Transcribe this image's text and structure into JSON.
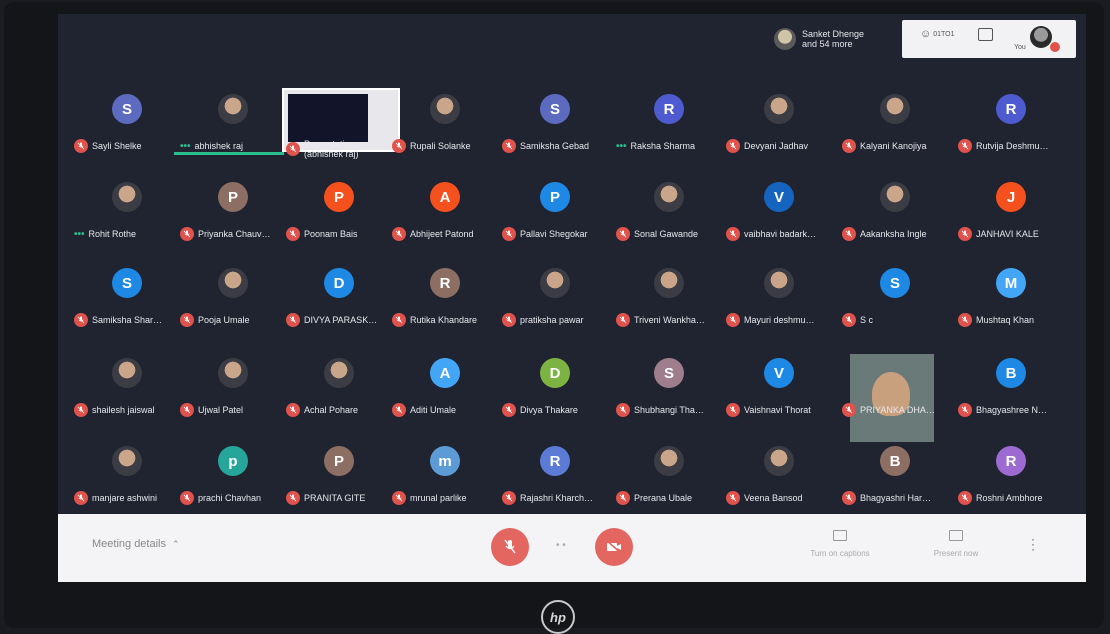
{
  "topbar": {
    "participants_text_line1": "Sanket Dhenge",
    "participants_text_line2": "and 54 more",
    "people_count": "01TO1",
    "you_label": "You"
  },
  "rows": [
    [
      {
        "name": "Sayli Shelke",
        "initial": "S",
        "color": "#5c6bc0",
        "muted": true
      },
      {
        "name": "abhishek raj",
        "initial": "",
        "color": "",
        "muted": false,
        "speaking": true
      },
      {
        "name": "Presentation (abhishek raj)",
        "initial": "",
        "color": "",
        "muted": true,
        "presentation": true
      },
      {
        "name": "Rupali Solanke",
        "initial": "",
        "color": "",
        "muted": true
      },
      {
        "name": "Samiksha Gebad",
        "initial": "S",
        "color": "#5c6bc0",
        "muted": true
      },
      {
        "name": "Raksha Sharma",
        "initial": "R",
        "color": "#4e5bd0",
        "muted": false,
        "speaking": true
      },
      {
        "name": "Devyani Jadhav",
        "initial": "",
        "color": "",
        "muted": true
      },
      {
        "name": "Kalyani Kanojiya",
        "initial": "",
        "color": "",
        "muted": true
      },
      {
        "name": "Rutvija Deshmu…",
        "initial": "R",
        "color": "#4e5bd0",
        "muted": true
      }
    ],
    [
      {
        "name": "Rohit Rothe",
        "initial": "",
        "color": "",
        "muted": false,
        "speaking": true
      },
      {
        "name": "Priyanka Chauv…",
        "initial": "P",
        "color": "#8d6e63",
        "muted": true
      },
      {
        "name": "Poonam Bais",
        "initial": "P",
        "color": "#f4511e",
        "muted": true
      },
      {
        "name": "Abhijeet Patond",
        "initial": "A",
        "color": "#f4511e",
        "muted": true
      },
      {
        "name": "Pallavi Shegokar",
        "initial": "P",
        "color": "#1e88e5",
        "muted": true
      },
      {
        "name": "Sonal Gawande",
        "initial": "",
        "color": "",
        "muted": true
      },
      {
        "name": "vaibhavi badark…",
        "initial": "V",
        "color": "#1565c0",
        "muted": true
      },
      {
        "name": "Aakanksha Ingle",
        "initial": "",
        "color": "",
        "muted": true
      },
      {
        "name": "JANHAVI KALE",
        "initial": "J",
        "color": "#f4511e",
        "muted": true
      }
    ],
    [
      {
        "name": "Samiksha Shar…",
        "initial": "S",
        "color": "#1e88e5",
        "muted": true
      },
      {
        "name": "Pooja Umale",
        "initial": "",
        "color": "",
        "muted": true
      },
      {
        "name": "DIVYA PARASK…",
        "initial": "D",
        "color": "#1e88e5",
        "muted": true
      },
      {
        "name": "Rutika Khandare",
        "initial": "R",
        "color": "#8d6e63",
        "muted": true
      },
      {
        "name": "pratiksha pawar",
        "initial": "",
        "color": "",
        "muted": true
      },
      {
        "name": "Triveni Wankha…",
        "initial": "",
        "color": "",
        "muted": true
      },
      {
        "name": "Mayuri deshmu…",
        "initial": "",
        "color": "",
        "muted": true
      },
      {
        "name": "S c",
        "initial": "S",
        "color": "#1e88e5",
        "muted": true
      },
      {
        "name": "Mushtaq Khan",
        "initial": "M",
        "color": "#42a5f5",
        "muted": true
      }
    ],
    [
      {
        "name": "shailesh jaiswal",
        "initial": "",
        "color": "",
        "muted": true
      },
      {
        "name": "Ujwal Patel",
        "initial": "",
        "color": "",
        "muted": true
      },
      {
        "name": "Achal Pohare",
        "initial": "",
        "color": "",
        "muted": true
      },
      {
        "name": "Aditi Umale",
        "initial": "A",
        "color": "#42a5f5",
        "muted": true
      },
      {
        "name": "Divya Thakare",
        "initial": "D",
        "color": "#7cb342",
        "muted": true
      },
      {
        "name": "Shubhangi Tha…",
        "initial": "S",
        "color": "#9e7e8c",
        "muted": true
      },
      {
        "name": "Vaishnavi Thorat",
        "initial": "V",
        "color": "#1e88e5",
        "muted": true
      },
      {
        "name": "PRIYANKA DHA…",
        "initial": "",
        "color": "",
        "muted": true,
        "video": true
      },
      {
        "name": "Bhagyashree N…",
        "initial": "B",
        "color": "#1e88e5",
        "muted": true
      }
    ],
    [
      {
        "name": "manjare ashwini",
        "initial": "",
        "color": "",
        "muted": true
      },
      {
        "name": "prachi Chavhan",
        "initial": "p",
        "color": "#26a69a",
        "muted": true
      },
      {
        "name": "PRANITA GITE",
        "initial": "P",
        "color": "#8d6e63",
        "muted": true
      },
      {
        "name": "mrunal parlike",
        "initial": "m",
        "color": "#5c9bd6",
        "muted": true
      },
      {
        "name": "Rajashri Kharch…",
        "initial": "R",
        "color": "#5c7bd6",
        "muted": true
      },
      {
        "name": "Prerana Ubale",
        "initial": "",
        "color": "",
        "muted": true
      },
      {
        "name": "Veena Bansod",
        "initial": "",
        "color": "",
        "muted": true
      },
      {
        "name": "Bhagyashri Har…",
        "initial": "B",
        "color": "#8d6e63",
        "muted": true
      },
      {
        "name": "Roshni Ambhore",
        "initial": "R",
        "color": "#9c6ad0",
        "muted": true
      }
    ]
  ],
  "bottombar": {
    "meeting_details": "Meeting details",
    "captions": "Turn on captions",
    "present_now": "Present now"
  },
  "brand": "hp"
}
